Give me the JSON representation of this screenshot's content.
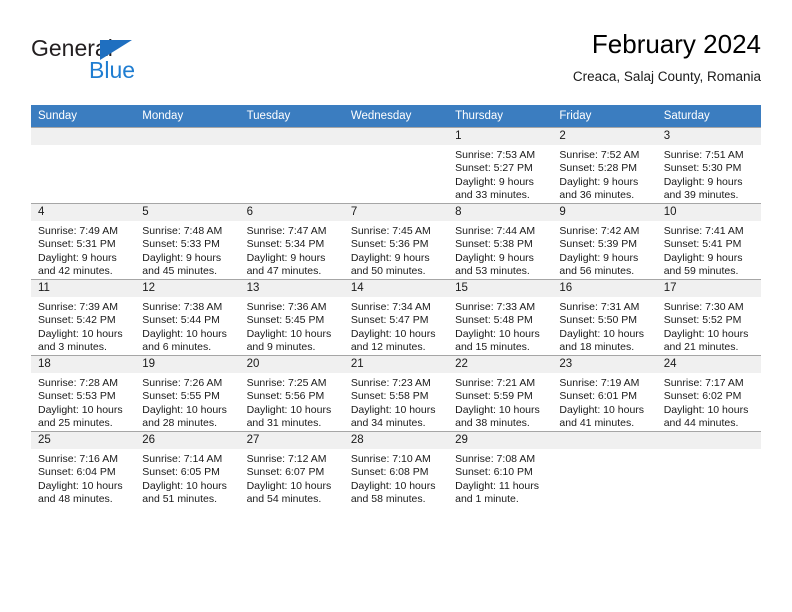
{
  "brand": {
    "name_top": "General",
    "name_bottom": "Blue",
    "triangle_color": "#1f6fc0",
    "blue_color": "#1f7dd1"
  },
  "header": {
    "title": "February 2024",
    "subtitle": "Creaca, Salaj County, Romania"
  },
  "theme": {
    "header_row_bg": "#3b7dc0",
    "header_row_text": "#ffffff",
    "daynum_bg": "#f0f0f0",
    "grid_line": "#9e9e9e"
  },
  "weekdays": [
    "Sunday",
    "Monday",
    "Tuesday",
    "Wednesday",
    "Thursday",
    "Friday",
    "Saturday"
  ],
  "labels": {
    "sunrise_prefix": "Sunrise:",
    "sunset_prefix": "Sunset:",
    "daylight_prefix": "Daylight:"
  },
  "weeks": [
    [
      {
        "day": "",
        "blank": true
      },
      {
        "day": "",
        "blank": true
      },
      {
        "day": "",
        "blank": true
      },
      {
        "day": "",
        "blank": true
      },
      {
        "day": "1",
        "sunrise": "Sunrise: 7:53 AM",
        "sunset": "Sunset: 5:27 PM",
        "daylight_l1": "Daylight: 9 hours",
        "daylight_l2": "and 33 minutes."
      },
      {
        "day": "2",
        "sunrise": "Sunrise: 7:52 AM",
        "sunset": "Sunset: 5:28 PM",
        "daylight_l1": "Daylight: 9 hours",
        "daylight_l2": "and 36 minutes."
      },
      {
        "day": "3",
        "sunrise": "Sunrise: 7:51 AM",
        "sunset": "Sunset: 5:30 PM",
        "daylight_l1": "Daylight: 9 hours",
        "daylight_l2": "and 39 minutes."
      }
    ],
    [
      {
        "day": "4",
        "sunrise": "Sunrise: 7:49 AM",
        "sunset": "Sunset: 5:31 PM",
        "daylight_l1": "Daylight: 9 hours",
        "daylight_l2": "and 42 minutes."
      },
      {
        "day": "5",
        "sunrise": "Sunrise: 7:48 AM",
        "sunset": "Sunset: 5:33 PM",
        "daylight_l1": "Daylight: 9 hours",
        "daylight_l2": "and 45 minutes."
      },
      {
        "day": "6",
        "sunrise": "Sunrise: 7:47 AM",
        "sunset": "Sunset: 5:34 PM",
        "daylight_l1": "Daylight: 9 hours",
        "daylight_l2": "and 47 minutes."
      },
      {
        "day": "7",
        "sunrise": "Sunrise: 7:45 AM",
        "sunset": "Sunset: 5:36 PM",
        "daylight_l1": "Daylight: 9 hours",
        "daylight_l2": "and 50 minutes."
      },
      {
        "day": "8",
        "sunrise": "Sunrise: 7:44 AM",
        "sunset": "Sunset: 5:38 PM",
        "daylight_l1": "Daylight: 9 hours",
        "daylight_l2": "and 53 minutes."
      },
      {
        "day": "9",
        "sunrise": "Sunrise: 7:42 AM",
        "sunset": "Sunset: 5:39 PM",
        "daylight_l1": "Daylight: 9 hours",
        "daylight_l2": "and 56 minutes."
      },
      {
        "day": "10",
        "sunrise": "Sunrise: 7:41 AM",
        "sunset": "Sunset: 5:41 PM",
        "daylight_l1": "Daylight: 9 hours",
        "daylight_l2": "and 59 minutes."
      }
    ],
    [
      {
        "day": "11",
        "sunrise": "Sunrise: 7:39 AM",
        "sunset": "Sunset: 5:42 PM",
        "daylight_l1": "Daylight: 10 hours",
        "daylight_l2": "and 3 minutes."
      },
      {
        "day": "12",
        "sunrise": "Sunrise: 7:38 AM",
        "sunset": "Sunset: 5:44 PM",
        "daylight_l1": "Daylight: 10 hours",
        "daylight_l2": "and 6 minutes."
      },
      {
        "day": "13",
        "sunrise": "Sunrise: 7:36 AM",
        "sunset": "Sunset: 5:45 PM",
        "daylight_l1": "Daylight: 10 hours",
        "daylight_l2": "and 9 minutes."
      },
      {
        "day": "14",
        "sunrise": "Sunrise: 7:34 AM",
        "sunset": "Sunset: 5:47 PM",
        "daylight_l1": "Daylight: 10 hours",
        "daylight_l2": "and 12 minutes."
      },
      {
        "day": "15",
        "sunrise": "Sunrise: 7:33 AM",
        "sunset": "Sunset: 5:48 PM",
        "daylight_l1": "Daylight: 10 hours",
        "daylight_l2": "and 15 minutes."
      },
      {
        "day": "16",
        "sunrise": "Sunrise: 7:31 AM",
        "sunset": "Sunset: 5:50 PM",
        "daylight_l1": "Daylight: 10 hours",
        "daylight_l2": "and 18 minutes."
      },
      {
        "day": "17",
        "sunrise": "Sunrise: 7:30 AM",
        "sunset": "Sunset: 5:52 PM",
        "daylight_l1": "Daylight: 10 hours",
        "daylight_l2": "and 21 minutes."
      }
    ],
    [
      {
        "day": "18",
        "sunrise": "Sunrise: 7:28 AM",
        "sunset": "Sunset: 5:53 PM",
        "daylight_l1": "Daylight: 10 hours",
        "daylight_l2": "and 25 minutes."
      },
      {
        "day": "19",
        "sunrise": "Sunrise: 7:26 AM",
        "sunset": "Sunset: 5:55 PM",
        "daylight_l1": "Daylight: 10 hours",
        "daylight_l2": "and 28 minutes."
      },
      {
        "day": "20",
        "sunrise": "Sunrise: 7:25 AM",
        "sunset": "Sunset: 5:56 PM",
        "daylight_l1": "Daylight: 10 hours",
        "daylight_l2": "and 31 minutes."
      },
      {
        "day": "21",
        "sunrise": "Sunrise: 7:23 AM",
        "sunset": "Sunset: 5:58 PM",
        "daylight_l1": "Daylight: 10 hours",
        "daylight_l2": "and 34 minutes."
      },
      {
        "day": "22",
        "sunrise": "Sunrise: 7:21 AM",
        "sunset": "Sunset: 5:59 PM",
        "daylight_l1": "Daylight: 10 hours",
        "daylight_l2": "and 38 minutes."
      },
      {
        "day": "23",
        "sunrise": "Sunrise: 7:19 AM",
        "sunset": "Sunset: 6:01 PM",
        "daylight_l1": "Daylight: 10 hours",
        "daylight_l2": "and 41 minutes."
      },
      {
        "day": "24",
        "sunrise": "Sunrise: 7:17 AM",
        "sunset": "Sunset: 6:02 PM",
        "daylight_l1": "Daylight: 10 hours",
        "daylight_l2": "and 44 minutes."
      }
    ],
    [
      {
        "day": "25",
        "sunrise": "Sunrise: 7:16 AM",
        "sunset": "Sunset: 6:04 PM",
        "daylight_l1": "Daylight: 10 hours",
        "daylight_l2": "and 48 minutes."
      },
      {
        "day": "26",
        "sunrise": "Sunrise: 7:14 AM",
        "sunset": "Sunset: 6:05 PM",
        "daylight_l1": "Daylight: 10 hours",
        "daylight_l2": "and 51 minutes."
      },
      {
        "day": "27",
        "sunrise": "Sunrise: 7:12 AM",
        "sunset": "Sunset: 6:07 PM",
        "daylight_l1": "Daylight: 10 hours",
        "daylight_l2": "and 54 minutes."
      },
      {
        "day": "28",
        "sunrise": "Sunrise: 7:10 AM",
        "sunset": "Sunset: 6:08 PM",
        "daylight_l1": "Daylight: 10 hours",
        "daylight_l2": "and 58 minutes."
      },
      {
        "day": "29",
        "sunrise": "Sunrise: 7:08 AM",
        "sunset": "Sunset: 6:10 PM",
        "daylight_l1": "Daylight: 11 hours",
        "daylight_l2": "and 1 minute."
      },
      {
        "day": "",
        "blank": true
      },
      {
        "day": "",
        "blank": true
      }
    ]
  ]
}
